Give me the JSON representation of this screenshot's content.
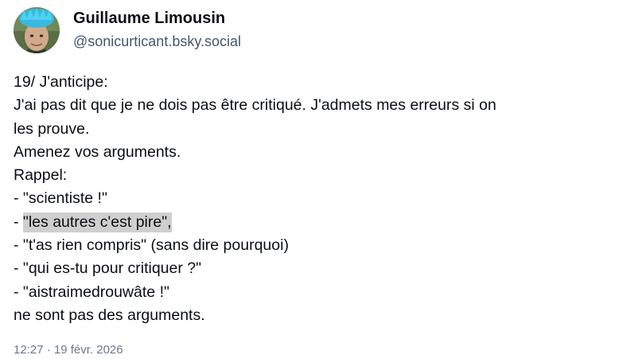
{
  "author": {
    "display_name": "Guillaume Limousin",
    "handle": "@sonicurticant.bsky.social",
    "avatar_icon": "avatar-photo"
  },
  "post": {
    "lines": [
      "19/ J'anticipe:",
      "J'ai pas dit que je ne dois pas être critiqué. J'admets mes erreurs si on",
      "les prouve.",
      "Amenez vos arguments.",
      "Rappel:",
      "- \"scientiste !\""
    ],
    "highlight_prefix": "- ",
    "highlight_text": "\"les autres c'est pire\",",
    "lines_after": [
      "- \"t'as rien compris\" (sans dire pourquoi)",
      "- \"qui es-tu pour critiquer ?\"",
      "- \"aistraimedrouwâte !\"",
      "ne sont pas des arguments."
    ],
    "timestamp": "12:27 · 19 févr. 2026"
  },
  "colors": {
    "text": "#0b0f14",
    "handle": "#42576c",
    "timestamp": "#6b7a8a",
    "highlight": "#cfcfcf"
  }
}
